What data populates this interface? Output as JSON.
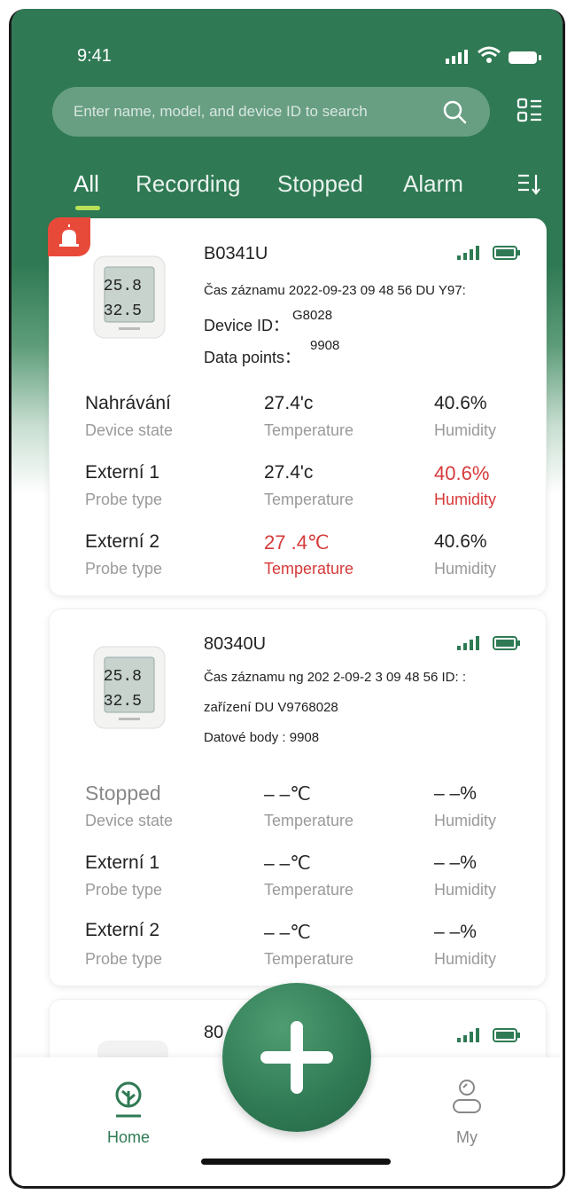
{
  "status_bar": {
    "time": "9:41"
  },
  "search": {
    "placeholder": "Enter name, model, and device ID to search"
  },
  "tabs": [
    "All",
    "Recording",
    "Stopped",
    "Alarm"
  ],
  "colors": {
    "brand_green": "#2f7a54",
    "alarm_red": "#e84a3a",
    "value_red": "#d63a3a",
    "tab_underline": "#b9e05a"
  },
  "devices": [
    {
      "name": "B0341U",
      "line1": "Čas záznamu 2022-09-23 09 48 56 DU Y97:",
      "line2_label": "Device ID：",
      "line2_value": "G8028",
      "line3_label": "Data points：",
      "line3_value": "9908",
      "rows": [
        {
          "c1_value": "Nahrávání",
          "c1_label": "Device state",
          "c2_value": "27.4'c",
          "c2_label": "Temperature",
          "c3_value": "40.6%",
          "c3_label": "Humidity"
        },
        {
          "c1_value": "Externí 1",
          "c1_label": "Probe type",
          "c2_value": "27.4'c",
          "c2_label": "Temperature",
          "c3_value": "40.6%",
          "c3_label": "Humidity"
        },
        {
          "c1_value": "Externí 2",
          "c1_label": "Probe type",
          "c2_value": "27 .4℃",
          "c2_label": "Temperature",
          "c3_value": "40.6%",
          "c3_label": "Humidity"
        }
      ]
    },
    {
      "name": "80340U",
      "line1": "Čas záznamu ng 202 2-09-2 3 09 48 56 ID: :",
      "line2": "zařízení DU V9768028",
      "line3": "Datové body : 9908",
      "rows": [
        {
          "c1_value": "Stopped",
          "c1_label": "Device state",
          "c2_value": "– –℃",
          "c2_label": "Temperature",
          "c3_value": "– –%",
          "c3_label": "Humidity"
        },
        {
          "c1_value": "Externí 1",
          "c1_label": "Probe type",
          "c2_value": "– –℃",
          "c2_label": "Temperature",
          "c3_value": "– –%",
          "c3_label": "Humidity"
        },
        {
          "c1_value": "Externí 2",
          "c1_label": "Probe type",
          "c2_value": "– –℃",
          "c2_label": "Temperature",
          "c3_value": "– –%",
          "c3_label": "Humidity"
        }
      ]
    },
    {
      "name": "80"
    }
  ],
  "thumb_readings": {
    "top": "25.8",
    "bottom": "32.5"
  },
  "nav": {
    "home_label": "Home",
    "my_label": "My"
  }
}
